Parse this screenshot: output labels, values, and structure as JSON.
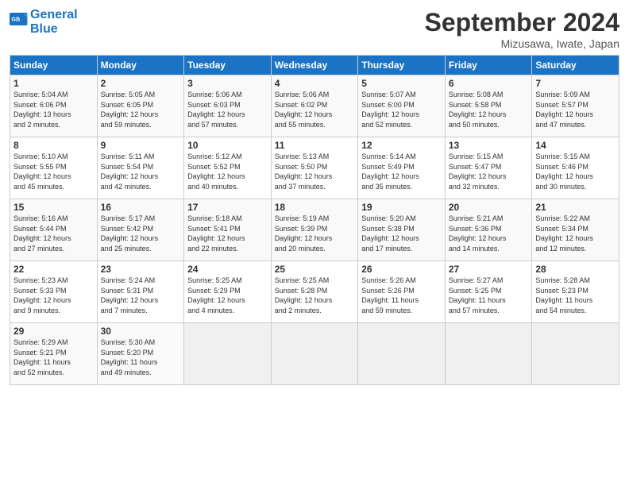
{
  "header": {
    "logo_line1": "General",
    "logo_line2": "Blue",
    "month_title": "September 2024",
    "location": "Mizusawa, Iwate, Japan"
  },
  "weekdays": [
    "Sunday",
    "Monday",
    "Tuesday",
    "Wednesday",
    "Thursday",
    "Friday",
    "Saturday"
  ],
  "weeks": [
    [
      {
        "day": "1",
        "info": "Sunrise: 5:04 AM\nSunset: 6:06 PM\nDaylight: 13 hours\nand 2 minutes."
      },
      {
        "day": "2",
        "info": "Sunrise: 5:05 AM\nSunset: 6:05 PM\nDaylight: 12 hours\nand 59 minutes."
      },
      {
        "day": "3",
        "info": "Sunrise: 5:06 AM\nSunset: 6:03 PM\nDaylight: 12 hours\nand 57 minutes."
      },
      {
        "day": "4",
        "info": "Sunrise: 5:06 AM\nSunset: 6:02 PM\nDaylight: 12 hours\nand 55 minutes."
      },
      {
        "day": "5",
        "info": "Sunrise: 5:07 AM\nSunset: 6:00 PM\nDaylight: 12 hours\nand 52 minutes."
      },
      {
        "day": "6",
        "info": "Sunrise: 5:08 AM\nSunset: 5:58 PM\nDaylight: 12 hours\nand 50 minutes."
      },
      {
        "day": "7",
        "info": "Sunrise: 5:09 AM\nSunset: 5:57 PM\nDaylight: 12 hours\nand 47 minutes."
      }
    ],
    [
      {
        "day": "8",
        "info": "Sunrise: 5:10 AM\nSunset: 5:55 PM\nDaylight: 12 hours\nand 45 minutes."
      },
      {
        "day": "9",
        "info": "Sunrise: 5:11 AM\nSunset: 5:54 PM\nDaylight: 12 hours\nand 42 minutes."
      },
      {
        "day": "10",
        "info": "Sunrise: 5:12 AM\nSunset: 5:52 PM\nDaylight: 12 hours\nand 40 minutes."
      },
      {
        "day": "11",
        "info": "Sunrise: 5:13 AM\nSunset: 5:50 PM\nDaylight: 12 hours\nand 37 minutes."
      },
      {
        "day": "12",
        "info": "Sunrise: 5:14 AM\nSunset: 5:49 PM\nDaylight: 12 hours\nand 35 minutes."
      },
      {
        "day": "13",
        "info": "Sunrise: 5:15 AM\nSunset: 5:47 PM\nDaylight: 12 hours\nand 32 minutes."
      },
      {
        "day": "14",
        "info": "Sunrise: 5:15 AM\nSunset: 5:46 PM\nDaylight: 12 hours\nand 30 minutes."
      }
    ],
    [
      {
        "day": "15",
        "info": "Sunrise: 5:16 AM\nSunset: 5:44 PM\nDaylight: 12 hours\nand 27 minutes."
      },
      {
        "day": "16",
        "info": "Sunrise: 5:17 AM\nSunset: 5:42 PM\nDaylight: 12 hours\nand 25 minutes."
      },
      {
        "day": "17",
        "info": "Sunrise: 5:18 AM\nSunset: 5:41 PM\nDaylight: 12 hours\nand 22 minutes."
      },
      {
        "day": "18",
        "info": "Sunrise: 5:19 AM\nSunset: 5:39 PM\nDaylight: 12 hours\nand 20 minutes."
      },
      {
        "day": "19",
        "info": "Sunrise: 5:20 AM\nSunset: 5:38 PM\nDaylight: 12 hours\nand 17 minutes."
      },
      {
        "day": "20",
        "info": "Sunrise: 5:21 AM\nSunset: 5:36 PM\nDaylight: 12 hours\nand 14 minutes."
      },
      {
        "day": "21",
        "info": "Sunrise: 5:22 AM\nSunset: 5:34 PM\nDaylight: 12 hours\nand 12 minutes."
      }
    ],
    [
      {
        "day": "22",
        "info": "Sunrise: 5:23 AM\nSunset: 5:33 PM\nDaylight: 12 hours\nand 9 minutes."
      },
      {
        "day": "23",
        "info": "Sunrise: 5:24 AM\nSunset: 5:31 PM\nDaylight: 12 hours\nand 7 minutes."
      },
      {
        "day": "24",
        "info": "Sunrise: 5:25 AM\nSunset: 5:29 PM\nDaylight: 12 hours\nand 4 minutes."
      },
      {
        "day": "25",
        "info": "Sunrise: 5:25 AM\nSunset: 5:28 PM\nDaylight: 12 hours\nand 2 minutes."
      },
      {
        "day": "26",
        "info": "Sunrise: 5:26 AM\nSunset: 5:26 PM\nDaylight: 11 hours\nand 59 minutes."
      },
      {
        "day": "27",
        "info": "Sunrise: 5:27 AM\nSunset: 5:25 PM\nDaylight: 11 hours\nand 57 minutes."
      },
      {
        "day": "28",
        "info": "Sunrise: 5:28 AM\nSunset: 5:23 PM\nDaylight: 11 hours\nand 54 minutes."
      }
    ],
    [
      {
        "day": "29",
        "info": "Sunrise: 5:29 AM\nSunset: 5:21 PM\nDaylight: 11 hours\nand 52 minutes."
      },
      {
        "day": "30",
        "info": "Sunrise: 5:30 AM\nSunset: 5:20 PM\nDaylight: 11 hours\nand 49 minutes."
      },
      {
        "day": "",
        "info": ""
      },
      {
        "day": "",
        "info": ""
      },
      {
        "day": "",
        "info": ""
      },
      {
        "day": "",
        "info": ""
      },
      {
        "day": "",
        "info": ""
      }
    ]
  ]
}
